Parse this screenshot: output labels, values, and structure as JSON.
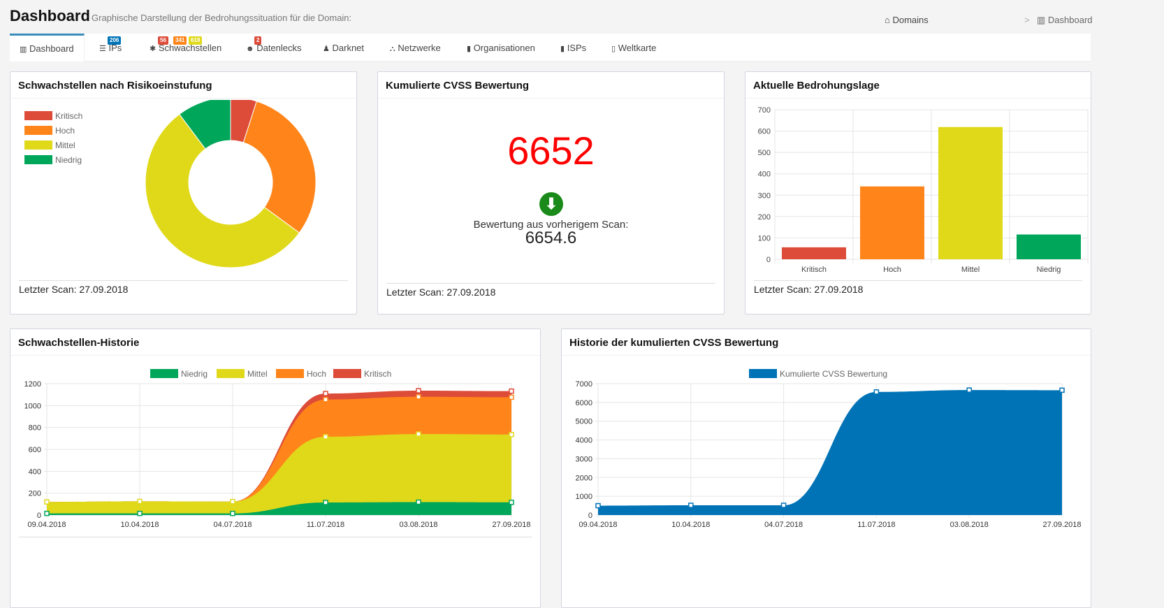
{
  "header": {
    "title": "Dashboard",
    "subtitle": "Graphische Darstellung der Bedrohungssituation für die Domain:"
  },
  "breadcrumb": {
    "home": "Domains",
    "separator": ">",
    "current": "Dashboard"
  },
  "tabs": [
    {
      "label": "Dashboard",
      "icon": "bar-chart-icon",
      "active": true
    },
    {
      "label": "IPs",
      "icon": "server-icon",
      "badges": [
        {
          "text": "206",
          "color": "#0073b7"
        }
      ]
    },
    {
      "label": "Schwachstellen",
      "icon": "bug-icon",
      "badges": [
        {
          "text": "56",
          "color": "#dd4b39"
        },
        {
          "text": "341",
          "color": "#ff851b"
        },
        {
          "text": "619",
          "color": "#e0d91a"
        }
      ]
    },
    {
      "label": "Datenlecks",
      "icon": "users-icon",
      "badges": [
        {
          "text": "2",
          "color": "#dd4b39"
        }
      ]
    },
    {
      "label": "Darknet",
      "icon": "user-secret-icon"
    },
    {
      "label": "Netzwerke",
      "icon": "sitemap-icon"
    },
    {
      "label": "Organisationen",
      "icon": "building-icon"
    },
    {
      "label": "ISPs",
      "icon": "building-icon"
    },
    {
      "label": "Weltkarte",
      "icon": "map-icon"
    }
  ],
  "panels": {
    "risk": {
      "title": "Schwachstellen nach Risikoeinstufung",
      "footer": "Letzter Scan: 27.09.2018"
    },
    "cvss": {
      "title": "Kumulierte CVSS Bewertung",
      "score": "6652",
      "score_color": "#ff0000",
      "trend": "down",
      "previous_label": "Bewertung aus vorherigem Scan:",
      "previous_score": "6654.6",
      "footer": "Letzter Scan: 27.09.2018"
    },
    "threat": {
      "title": "Aktuelle Bedrohungslage",
      "footer": "Letzter Scan: 27.09.2018"
    },
    "history": {
      "title": "Schwachstellen-Historie"
    },
    "cvss_history": {
      "title": "Historie der kumulierten CVSS Bewertung"
    }
  },
  "chart_data": [
    {
      "type": "pie",
      "variant": "doughnut",
      "categories": [
        "Kritisch",
        "Hoch",
        "Mittel",
        "Niedrig"
      ],
      "values": [
        56,
        341,
        619,
        116
      ],
      "colors": [
        "#dd4b39",
        "#ff851b",
        "#e0d91a",
        "#00a65a"
      ],
      "legend": "top-left"
    },
    {
      "type": "bar",
      "categories": [
        "Kritisch",
        "Hoch",
        "Mittel",
        "Niedrig"
      ],
      "values": [
        56,
        341,
        619,
        116
      ],
      "colors": [
        "#dd4b39",
        "#ff851b",
        "#e0d91a",
        "#00a65a"
      ],
      "ylim": [
        0,
        700
      ],
      "yticks": [
        0,
        100,
        200,
        300,
        400,
        500,
        600,
        700
      ],
      "grid": true
    },
    {
      "type": "area",
      "stacked": true,
      "x": [
        "09.04.2018",
        "10.04.2018",
        "04.07.2018",
        "11.07.2018",
        "03.08.2018",
        "27.09.2018"
      ],
      "series": [
        {
          "name": "Niedrig",
          "color": "#00a65a",
          "values": [
            15,
            15,
            15,
            115,
            118,
            116
          ]
        },
        {
          "name": "Mittel",
          "color": "#e0d91a",
          "values": [
            105,
            110,
            108,
            600,
            622,
            619
          ]
        },
        {
          "name": "Hoch",
          "color": "#ff851b",
          "values": [
            0,
            0,
            0,
            340,
            340,
            341
          ]
        },
        {
          "name": "Kritisch",
          "color": "#dd4b39",
          "values": [
            0,
            0,
            0,
            55,
            56,
            56
          ]
        }
      ],
      "ylim": [
        0,
        1200
      ],
      "yticks": [
        0,
        200,
        400,
        600,
        800,
        1000,
        1200
      ],
      "legend": "top",
      "grid": true
    },
    {
      "type": "area",
      "x": [
        "09.04.2018",
        "10.04.2018",
        "04.07.2018",
        "11.07.2018",
        "03.08.2018",
        "27.09.2018"
      ],
      "series": [
        {
          "name": "Kumulierte CVSS Bewertung",
          "color": "#0073b7",
          "values": [
            500,
            520,
            520,
            6560,
            6660,
            6652
          ]
        }
      ],
      "ylim": [
        0,
        7000
      ],
      "yticks": [
        0,
        1000,
        2000,
        3000,
        4000,
        5000,
        6000,
        7000
      ],
      "legend": "top",
      "grid": true
    }
  ]
}
